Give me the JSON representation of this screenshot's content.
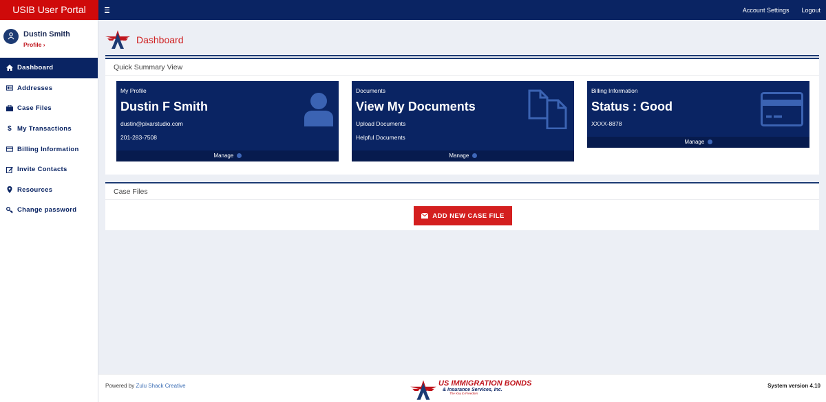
{
  "app": {
    "title": "USIB User Portal"
  },
  "topbar": {
    "account_settings": "Account Settings",
    "logout": "Logout"
  },
  "user": {
    "name": "Dustin Smith",
    "profile_link": "Profile ›"
  },
  "sidebar": {
    "items": [
      {
        "label": "Dashboard",
        "icon": "home-icon",
        "active": true
      },
      {
        "label": "Addresses",
        "icon": "address-card-icon"
      },
      {
        "label": "Case Files",
        "icon": "briefcase-icon"
      },
      {
        "label": "My Transactions",
        "icon": "dollar-icon"
      },
      {
        "label": "Billing Information",
        "icon": "credit-card-icon"
      },
      {
        "label": "Invite Contacts",
        "icon": "edit-icon"
      },
      {
        "label": "Resources",
        "icon": "map-pin-icon"
      },
      {
        "label": "Change password",
        "icon": "key-icon"
      }
    ]
  },
  "page": {
    "title": "Dashboard"
  },
  "summary": {
    "title": "Quick Summary View",
    "cards": [
      {
        "label": "My Profile",
        "title": "Dustin F Smith",
        "line1": "dustin@pixarstudio.com",
        "line2": "201-283-7508",
        "manage": "Manage",
        "icon": "user-icon"
      },
      {
        "label": "Documents",
        "title": "View My Documents",
        "line1": "Upload Documents",
        "line2": "Helpful Documents",
        "manage": "Manage",
        "icon": "documents-icon"
      },
      {
        "label": "Billing Information",
        "title": "Status : Good",
        "line1": "XXXX-8878",
        "manage": "Manage",
        "icon": "credit-card-icon"
      }
    ]
  },
  "case_files": {
    "title": "Case Files",
    "add_button": "ADD NEW CASE FILE"
  },
  "footer": {
    "powered_by": "Powered by",
    "powered_link": "Zulu Shack Creative",
    "logo_line1": "US IMMIGRATION BONDS",
    "logo_line2": "& Insurance Services, Inc.",
    "logo_tagline": "The Key to Freedom",
    "version": "System version 4.10"
  },
  "colors": {
    "navy": "#0a2463",
    "red": "#cf0a0a",
    "background": "#eceff5"
  }
}
